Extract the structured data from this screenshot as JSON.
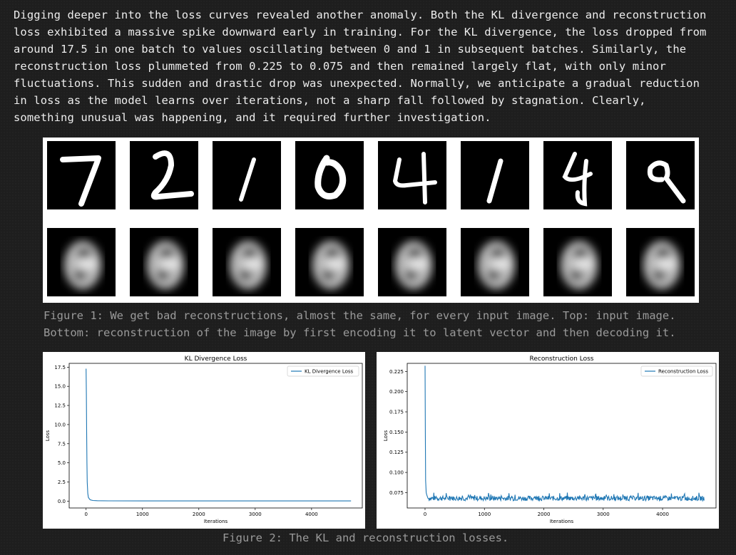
{
  "paragraph": [
    "Digging deeper into the loss curves revealed another anomaly. Both the KL divergence and reconstruction",
    "loss exhibited a massive spike downward early in training. For the KL divergence, the loss dropped from",
    "around 17.5 in one batch to values oscillating between 0 and 1 in subsequent batches. Similarly, the",
    "reconstruction loss plummeted from 0.225 to 0.075 and then remained largely flat, with only minor",
    "fluctuations. This sudden and drastic drop was unexpected. Normally, we anticipate a gradual reduction",
    "in loss as the model learns over iterations, not a sharp fall followed by stagnation. Clearly,",
    "something unusual was happening, and it required further investigation."
  ],
  "figure1": {
    "caption_line1": "Figure 1: We get bad reconstructions, almost the same, for every input image. Top: input image.",
    "caption_line2": "Bottom: reconstruction of the image by first encoding it to latent vector and then decoding it.",
    "input_digits": [
      "7",
      "2",
      "1",
      "0",
      "4",
      "1",
      "4",
      "9"
    ]
  },
  "figure2": {
    "caption": "Figure 2: The KL and reconstruction losses."
  },
  "chart_data": [
    {
      "type": "line",
      "title": "KL Divergence Loss",
      "xlabel": "Iterations",
      "ylabel": "Loss",
      "xlim": [
        -300,
        4900
      ],
      "ylim": [
        -0.9,
        18.0
      ],
      "xticks": [
        "0",
        "1000",
        "2000",
        "3000",
        "4000"
      ],
      "yticks": [
        "0.0",
        "2.5",
        "5.0",
        "7.5",
        "10.0",
        "12.5",
        "15.0",
        "17.5"
      ],
      "legend": "top-right",
      "color": "#1f77b4",
      "series": [
        {
          "name": "KL Divergence Loss",
          "x": [
            0,
            5,
            10,
            15,
            20,
            30,
            40,
            60,
            80,
            120,
            200,
            400,
            1000,
            2000,
            3000,
            4000,
            4700
          ],
          "y": [
            17.3,
            14.0,
            9.0,
            5.0,
            2.5,
            1.0,
            0.5,
            0.25,
            0.15,
            0.08,
            0.05,
            0.03,
            0.02,
            0.02,
            0.02,
            0.02,
            0.02
          ]
        }
      ]
    },
    {
      "type": "line",
      "title": "Reconstruction Loss",
      "xlabel": "Iterations",
      "ylabel": "Loss",
      "xlim": [
        -300,
        4900
      ],
      "ylim": [
        0.056,
        0.235
      ],
      "xticks": [
        "0",
        "1000",
        "2000",
        "3000",
        "4000"
      ],
      "yticks": [
        "0.075",
        "0.100",
        "0.125",
        "0.150",
        "0.175",
        "0.200",
        "0.225"
      ],
      "legend": "top-right",
      "color": "#1f77b4",
      "series": [
        {
          "name": "Reconstruction Loss",
          "x": [
            0,
            5,
            10,
            20,
            30,
            50,
            4700
          ],
          "y": [
            0.232,
            0.15,
            0.09,
            0.075,
            0.072,
            0.068,
            0.067
          ],
          "noise_band": [
            0.062,
            0.074
          ]
        }
      ]
    }
  ]
}
